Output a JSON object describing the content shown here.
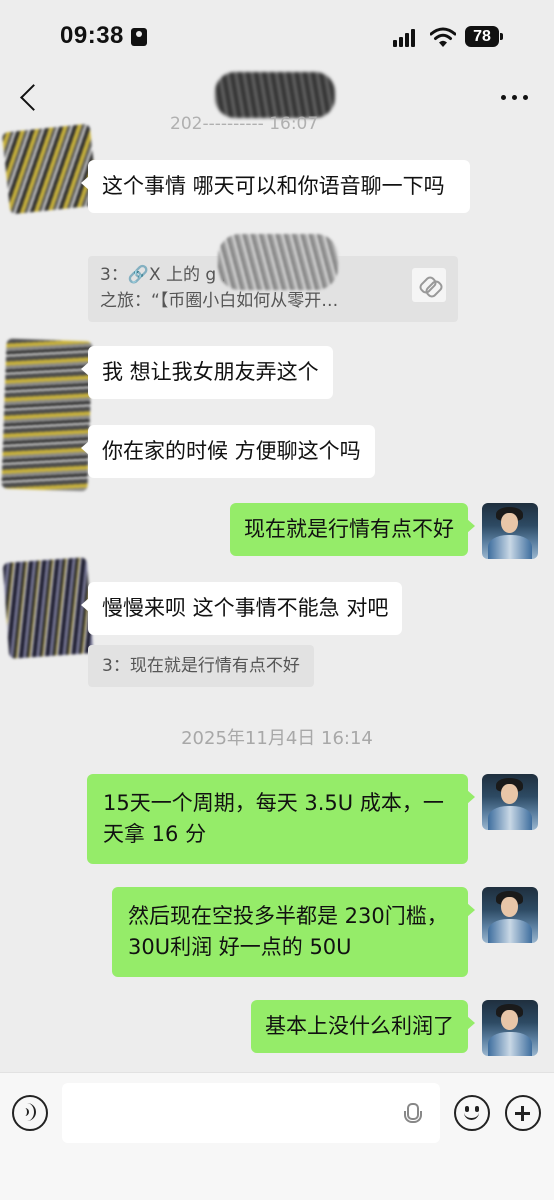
{
  "status_bar": {
    "time": "09:38",
    "battery": "78"
  },
  "nav": {
    "back_icon": "chevron-left-icon",
    "more_icon": "more-dots-icon"
  },
  "partial_timestamp": "202‑‑‑‑‑‑‑‑‑‑ 16:07",
  "messages": [
    {
      "side": "left",
      "text": "这个事情 哪天可以和你语音聊一下吗"
    },
    {
      "side": "left",
      "text": "我 想让我女朋友弄这个"
    },
    {
      "side": "left",
      "text": "你在家的时候 方便聊这个吗"
    },
    {
      "side": "right",
      "text": "现在就是行情有点不好"
    },
    {
      "side": "left",
      "text": "慢慢来呗 这个事情不能急 对吧"
    },
    {
      "side": "right",
      "text": "15天一个周期，每天 3.5U 成本，一天拿 16 分"
    },
    {
      "side": "right",
      "text": "然后现在空投多半都是 230门槛，30U利润 好一点的 50U"
    },
    {
      "side": "right",
      "text": "基本上没什么利润了"
    }
  ],
  "quotes": {
    "q1_line1": "3：🔗X 上的              g 的撸毛",
    "q1_line2": "之旅：“【币圈小白如何从零开…",
    "q2": "3：现在就是行情有点不好"
  },
  "timestamp": "2025年11月4日 16:14",
  "input_bar": {
    "placeholder": "",
    "voice_icon": "voice-icon",
    "mic_icon": "mic-icon",
    "emoji_icon": "emoji-icon",
    "plus_icon": "plus-icon"
  },
  "colors": {
    "background": "#ededed",
    "bubble_green": "#95ec69",
    "bubble_white": "#ffffff"
  }
}
